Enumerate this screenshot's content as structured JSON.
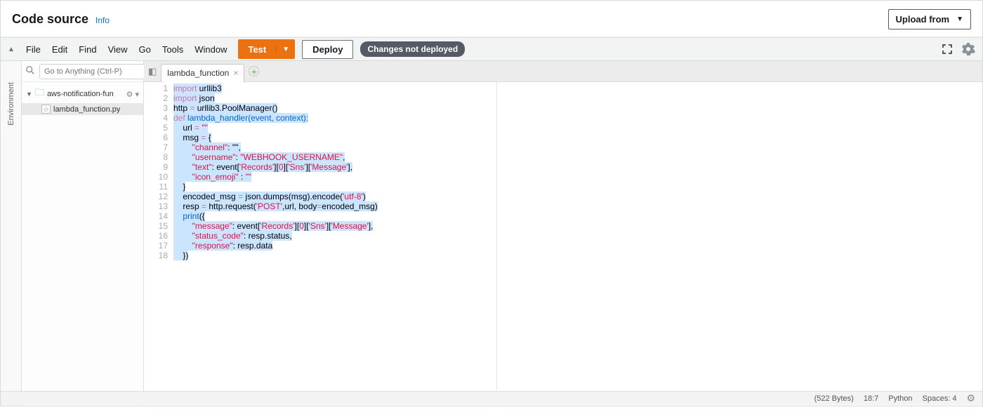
{
  "header": {
    "title": "Code source",
    "info": "Info",
    "upload": "Upload from"
  },
  "toolbar": {
    "menus": [
      "File",
      "Edit",
      "Find",
      "View",
      "Go",
      "Tools",
      "Window"
    ],
    "test": "Test",
    "deploy": "Deploy",
    "status": "Changes not deployed"
  },
  "sidebar": {
    "tab": "Environment",
    "search_placeholder": "Go to Anything (Ctrl-P)",
    "project_name": "aws-notification-fun",
    "file_name": "lambda_function.py"
  },
  "editor": {
    "tab_name": "lambda_function",
    "line_count": 18,
    "tokens": {
      "import": "import",
      "urllib3": " urllib3",
      "json": " json",
      "http": "http ",
      "eq": "=",
      "pm": " urllib3.PoolManager()",
      "def": "def",
      "lh": " lambda_handler(event, context):",
      "url": "    url ",
      "eq2": "=",
      "emp": " \"\"",
      "msg": "    msg ",
      "eq3": "=",
      "brace": " {",
      "ch_k": "        \"channel\"",
      "ch_v": ": \"\",",
      "un_k": "        \"username\"",
      "un_c": ": ",
      "un_v": "\"WEBHOOK_USERNAME\"",
      "comma": ",",
      "tx_k": "        \"text\"",
      "tx_c": ": event[",
      "rec": "'Records'",
      "br0": "][",
      "zero": "0",
      "br1": "][",
      "sns": "'Sns'",
      "br2": "][",
      "msgk": "'Message'",
      "br3": "],",
      "ie_k": "        \"icon_emoji\"",
      "ie_c": " : ",
      "ie_v": "\"\"",
      "cb": "    }",
      "enc": "    encoded_msg ",
      "eq4": "=",
      "jd": " json.dumps(msg).encode(",
      "utf": "'utf-8'",
      "cp": ")",
      "resp": "    resp ",
      "eq5": "=",
      "hr": " http.request(",
      "post": "'POST'",
      "hr2": ",url, body",
      "eq6": "=",
      "hr3": "encoded_msg)",
      "print": "    print",
      "po": "({",
      "mk": "        \"message\"",
      "mc": ": event[",
      "rec2": "'Records'",
      "br0b": "][",
      "zero2": "0",
      "br1b": "][",
      "sns2": "'Sns'",
      "br2b": "][",
      "msg2": "'Message'",
      "br3b": "],",
      "sc_k": "        \"status_code\"",
      "sc_v": ": resp.status,",
      "rp_k": "        \"response\"",
      "rp_v": ": resp.data",
      "end": "    })"
    }
  },
  "statusbar": {
    "size": "(522 Bytes)",
    "pos": "18:7",
    "lang": "Python",
    "spaces": "Spaces: 4"
  }
}
